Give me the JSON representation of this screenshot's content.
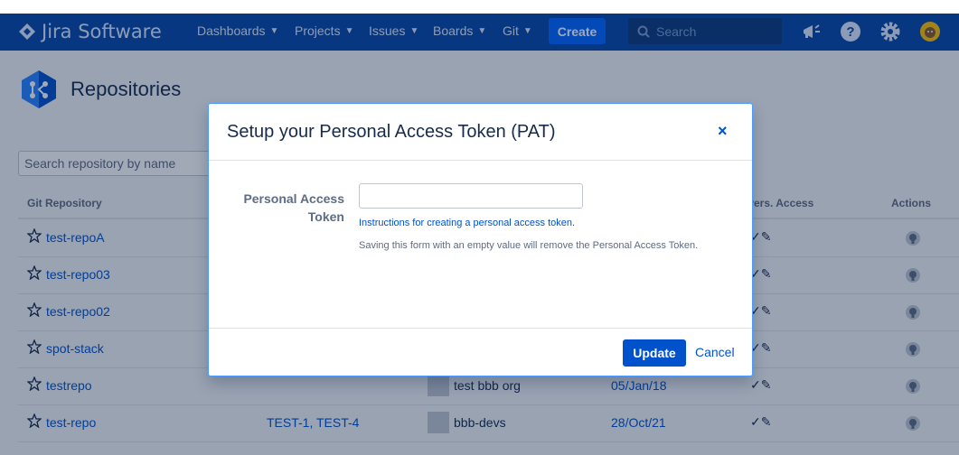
{
  "topbar": {
    "brand": "Jira Software",
    "nav": [
      {
        "label": "Dashboards"
      },
      {
        "label": "Projects"
      },
      {
        "label": "Issues"
      },
      {
        "label": "Boards"
      },
      {
        "label": "Git"
      }
    ],
    "create_label": "Create",
    "search_placeholder": "Search",
    "icons": [
      "megaphone-icon",
      "help-icon",
      "settings-icon",
      "avatar"
    ]
  },
  "page": {
    "title": "Repositories",
    "search_placeholder": "Search repository by name",
    "columns": {
      "repository": "Git Repository",
      "pers_access": "Pers. Access",
      "actions": "Actions"
    },
    "rows": [
      {
        "name": "test-repoA",
        "issues": "",
        "org": "",
        "date": ""
      },
      {
        "name": "test-repo03",
        "issues": "",
        "org": "",
        "date": ""
      },
      {
        "name": "test-repo02",
        "issues": "",
        "org": "",
        "date": ""
      },
      {
        "name": "spot-stack",
        "issues": "",
        "org": "",
        "date": ""
      },
      {
        "name": "testrepo",
        "issues": "",
        "org": "test bbb org",
        "date": "05/Jan/18"
      },
      {
        "name": "test-repo",
        "issues": "TEST-1, TEST-4",
        "org": "bbb-devs",
        "date": "28/Oct/21"
      }
    ],
    "pers_access_marks": "✓✎"
  },
  "modal": {
    "title": "Setup your Personal Access Token (PAT)",
    "close_label": "×",
    "field_label_line1": "Personal Access",
    "field_label_line2": "Token",
    "token_value": "",
    "help_link": "Instructions for creating a personal access token.",
    "help_text": "Saving this form with an empty value will remove the Personal Access Token.",
    "update_label": "Update",
    "cancel_label": "Cancel"
  },
  "colors": {
    "topbar": "#0747a6",
    "primary": "#0052cc",
    "focus_border": "#4c9aff"
  }
}
